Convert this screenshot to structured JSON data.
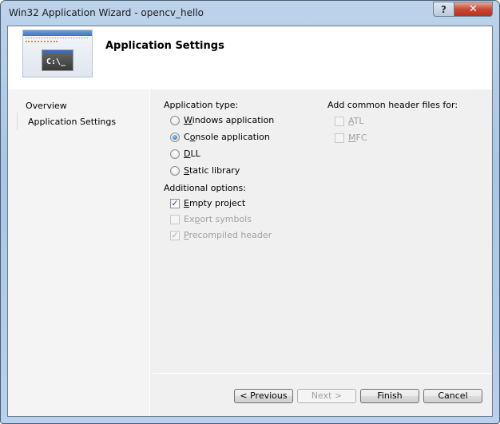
{
  "window": {
    "title": "Win32 Application Wizard - opencv_hello",
    "help_glyph": "?",
    "close_glyph": "✕"
  },
  "header": {
    "title": "Application Settings",
    "icon_prompt": "C:\\_"
  },
  "sidebar": {
    "items": [
      {
        "label": "Overview",
        "selected": false
      },
      {
        "label": "Application Settings",
        "selected": true
      }
    ]
  },
  "application_type": {
    "label": "Application type:",
    "options": [
      {
        "pre": "",
        "accel": "W",
        "post": "indows application",
        "checked": false
      },
      {
        "pre": "C",
        "accel": "o",
        "post": "nsole application",
        "checked": true
      },
      {
        "pre": "",
        "accel": "D",
        "post": "LL",
        "checked": false
      },
      {
        "pre": "",
        "accel": "S",
        "post": "tatic library",
        "checked": false
      }
    ]
  },
  "additional_options": {
    "label": "Additional options:",
    "options": [
      {
        "pre": "",
        "accel": "E",
        "post": "mpty project",
        "checked": true,
        "enabled": true
      },
      {
        "pre": "Ex",
        "accel": "p",
        "post": "ort symbols",
        "checked": false,
        "enabled": false
      },
      {
        "pre": "",
        "accel": "P",
        "post": "recompiled header",
        "checked": true,
        "enabled": false
      }
    ]
  },
  "header_files": {
    "label": "Add common header files for:",
    "options": [
      {
        "pre": "",
        "accel": "A",
        "post": "TL",
        "checked": false,
        "enabled": false
      },
      {
        "pre": "",
        "accel": "M",
        "post": "FC",
        "checked": false,
        "enabled": false
      }
    ]
  },
  "buttons": {
    "previous": "< Previous",
    "next": "Next >",
    "finish": "Finish",
    "cancel": "Cancel"
  },
  "check_glyph": "✓"
}
